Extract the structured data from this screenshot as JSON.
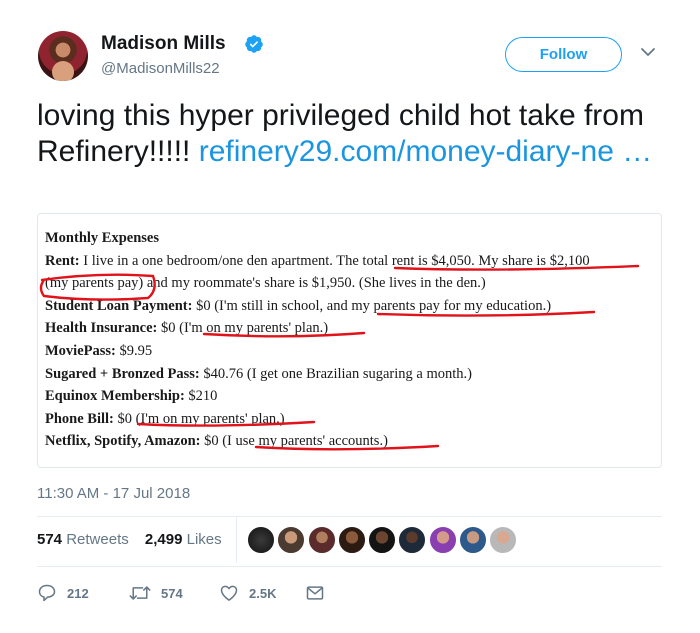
{
  "author": {
    "name": "Madison Mills",
    "handle": "@MadisonMills22",
    "verified": true
  },
  "follow_label": "Follow",
  "tweet": {
    "text": "loving this hyper privileged child hot take from Refinery!!!!! ",
    "link": "refinery29.com/money-diary-ne …"
  },
  "card": {
    "heading": "Monthly Expenses",
    "items": [
      {
        "label": "Rent:",
        "text": " I live in a one bedroom/one den apartment. The total rent is $4,050. My share is $2,100"
      },
      {
        "label": "",
        "text": "(my parents pay) and my roommate's share is $1,950. (She lives in the den.)"
      },
      {
        "label": "Student Loan Payment:",
        "text": " $0 (I'm still in school, and my parents pay for my education.)"
      },
      {
        "label": "Health Insurance:",
        "text": " $0 (I'm on my parents' plan.)"
      },
      {
        "label": "MoviePass:",
        "text": " $9.95"
      },
      {
        "label": "Sugared + Bronzed Pass:",
        "text": " $40.76 (I get one Brazilian sugaring a month.)"
      },
      {
        "label": "Equinox Membership:",
        "text": " $210"
      },
      {
        "label": "Phone Bill:",
        "text": " $0 (I'm on my parents' plan.)"
      },
      {
        "label": "Netflix, Spotify, Amazon:",
        "text": " $0 (I use my parents' accounts.)"
      }
    ],
    "annotation_color": "#e0131b"
  },
  "timestamp": "11:30 AM - 17 Jul 2018",
  "stats": {
    "retweets_count": "574",
    "retweets_label": "Retweets",
    "likes_count": "2,499",
    "likes_label": "Likes"
  },
  "actions": {
    "replies": "212",
    "retweets": "574",
    "likes": "2.5K"
  },
  "colors": {
    "accent": "#1da1f2",
    "link": "#1b95e0",
    "muted": "#657786"
  }
}
